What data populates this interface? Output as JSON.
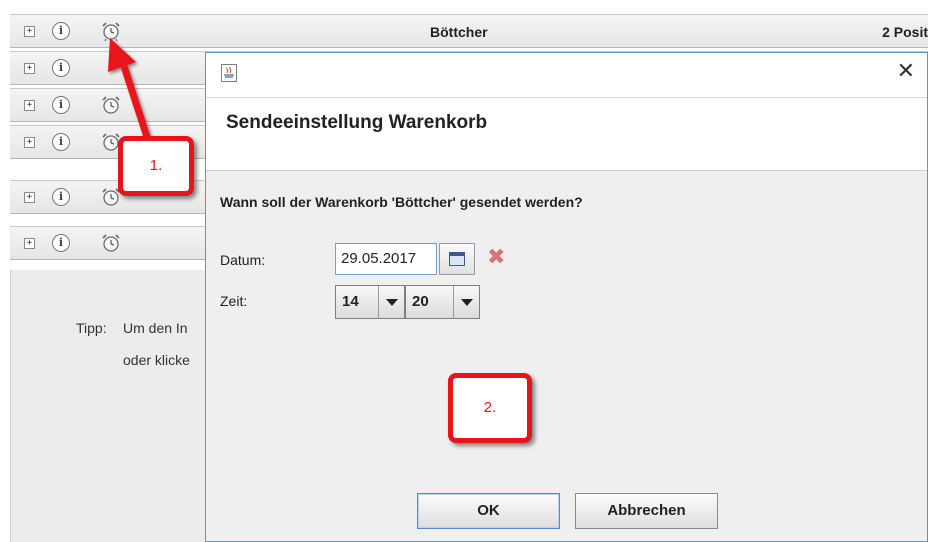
{
  "list": {
    "rows": [
      {
        "title": "Böttcher",
        "count": "2 Posit"
      },
      {
        "title": "",
        "count": ""
      },
      {
        "title": "",
        "count": ""
      },
      {
        "title": "",
        "count": ""
      },
      {
        "title": "",
        "count": ""
      },
      {
        "title": "",
        "count": ""
      }
    ],
    "expand_symbol": "+",
    "info_symbol": "i"
  },
  "tip": {
    "label": "Tipp:",
    "line1": "Um den In",
    "line2": "oder klicke"
  },
  "dialog": {
    "close_symbol": "✕",
    "header_title": "Sendeeinstellung Warenkorb",
    "question": "Wann soll der Warenkorb 'Böttcher' gesendet werden?",
    "date_label": "Datum:",
    "date_value": "29.05.2017",
    "clear_symbol": "✖",
    "time_label": "Zeit:",
    "hour_value": "14",
    "minute_value": "20",
    "ok_label": "OK",
    "cancel_label": "Abbrechen"
  },
  "annotations": {
    "step1": "1.",
    "step2": "2.",
    "color": "#e8141b"
  },
  "icons": [
    "expand-icon",
    "info-icon",
    "alarm-clock-icon",
    "java-icon",
    "close-icon",
    "calendar-icon",
    "clear-icon",
    "dropdown-arrow-icon"
  ]
}
